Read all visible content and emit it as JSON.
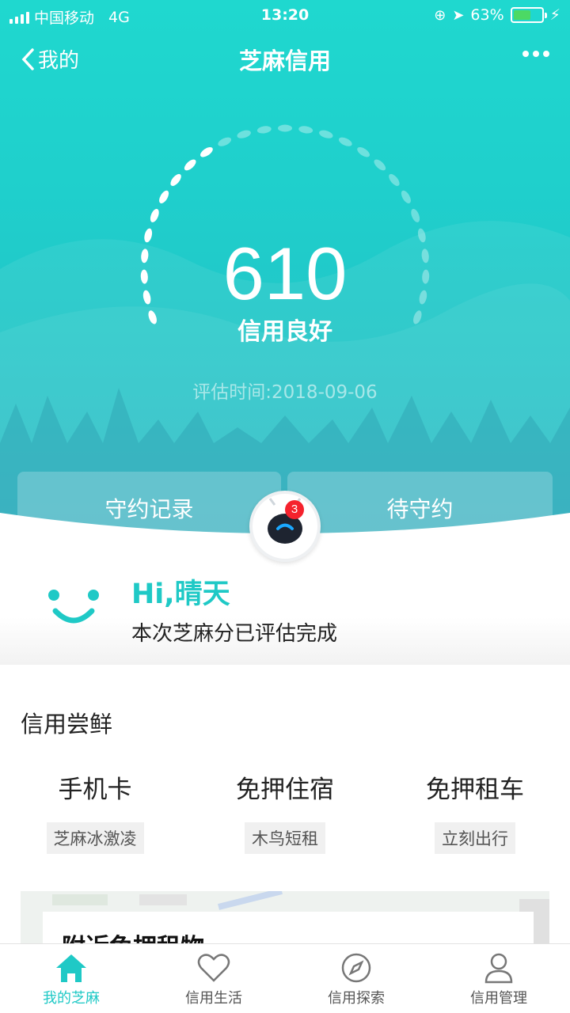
{
  "status_bar": {
    "carrier": "中国移动",
    "network": "4G",
    "time": "13:20",
    "battery": "63%",
    "battery_level": 0.63
  },
  "nav": {
    "back_label": "我的",
    "title": "芝麻信用"
  },
  "score": {
    "value": "610",
    "grade": "信用良好",
    "evaluated": "评估时间:2018-09-06"
  },
  "tabs": {
    "left": "守约记录",
    "right": "待守约"
  },
  "assistant": {
    "badge_count": "3",
    "greeting": "Hi,晴天",
    "message": "本次芝麻分已评估完成"
  },
  "section": {
    "title": "信用尝鲜",
    "items": [
      {
        "name": "手机卡",
        "tag": "芝麻冰激凌"
      },
      {
        "name": "免押住宿",
        "tag": "木鸟短租"
      },
      {
        "name": "免押租车",
        "tag": "立刻出行"
      }
    ]
  },
  "map_card": {
    "title": "附近免押租物"
  },
  "tabbar": {
    "items": [
      {
        "label": "我的芝麻",
        "icon": "home-icon"
      },
      {
        "label": "信用生活",
        "icon": "heart-icon"
      },
      {
        "label": "信用探索",
        "icon": "compass-icon"
      },
      {
        "label": "信用管理",
        "icon": "user-icon"
      }
    ]
  },
  "colors": {
    "accent": "#1fc9c6",
    "badge": "#f5222d"
  }
}
